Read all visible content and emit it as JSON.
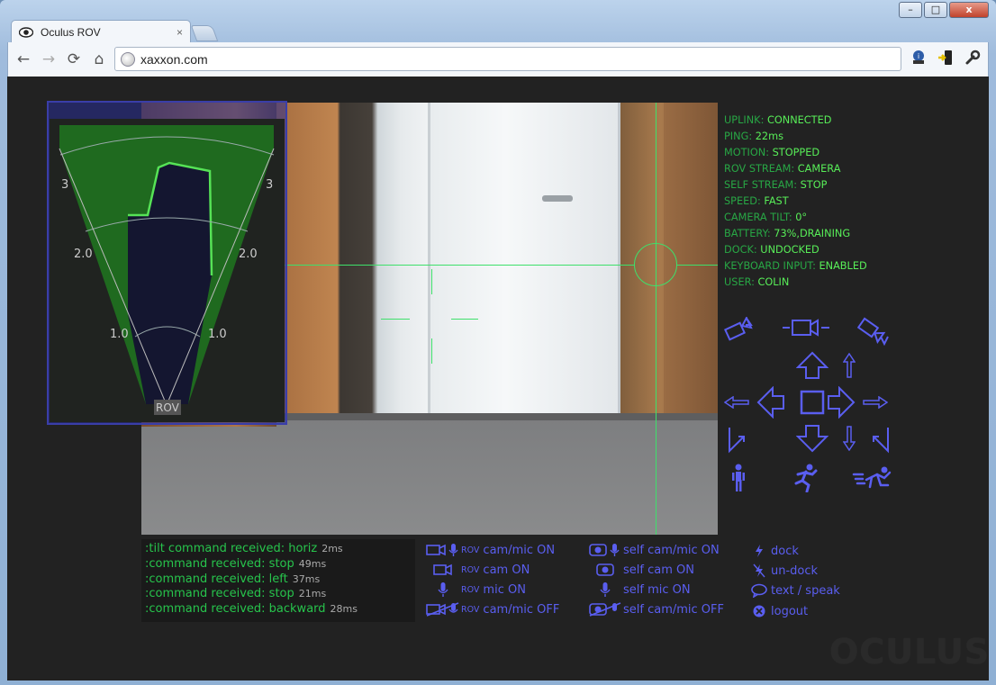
{
  "browser": {
    "tab_title": "Oculus ROV",
    "tab_close": "×",
    "url": "xaxxon.com",
    "controls": {
      "minimize": "–",
      "maximize": "□",
      "close": "x"
    },
    "nav": {
      "back": "←",
      "forward": "→",
      "reload": "⟳",
      "home": "⌂"
    }
  },
  "radar": {
    "labels": {
      "left_outer": "3",
      "right_outer": "3",
      "left_mid": "2.0",
      "right_mid": "2.0",
      "left_near": "1.0",
      "right_near": "1.0",
      "origin": "ROV"
    },
    "colors": {
      "fov": "#1f6a1f",
      "obstacle": "#56e356",
      "free": "#141630"
    }
  },
  "status": [
    {
      "key": "UPLINK:",
      "value": "CONNECTED"
    },
    {
      "key": "PING:",
      "value": "22ms"
    },
    {
      "key": "MOTION:",
      "value": "STOPPED"
    },
    {
      "key": "ROV STREAM:",
      "value": "CAMERA"
    },
    {
      "key": "SELF STREAM:",
      "value": "STOP"
    },
    {
      "key": "SPEED:",
      "value": "FAST"
    },
    {
      "key": "CAMERA TILT:",
      "value": "0°"
    },
    {
      "key": "BATTERY:",
      "value": "73%,DRAINING"
    },
    {
      "key": "DOCK:",
      "value": "UNDOCKED"
    },
    {
      "key": "KEYBOARD INPUT:",
      "value": "ENABLED"
    },
    {
      "key": "USER:",
      "value": "COLIN"
    }
  ],
  "console": [
    {
      "msg": ":tilt command received: horiz",
      "time": "2ms"
    },
    {
      "msg": ":command received: stop",
      "time": "49ms"
    },
    {
      "msg": ":command received: left",
      "time": "37ms"
    },
    {
      "msg": ":command received: stop",
      "time": "21ms"
    },
    {
      "msg": ":command received: backward",
      "time": "28ms"
    }
  ],
  "media": {
    "rov": [
      {
        "prefix": "ROV",
        "label": "cam/mic ON",
        "icon": "camera-mic-icon"
      },
      {
        "prefix": "ROV",
        "label": "cam ON",
        "icon": "camera-icon"
      },
      {
        "prefix": "ROV",
        "label": "mic ON",
        "icon": "mic-icon"
      },
      {
        "prefix": "ROV",
        "label": "cam/mic OFF",
        "icon": "camera-mic-off-icon"
      }
    ],
    "self": [
      {
        "label": "self cam/mic ON",
        "icon": "webcam-mic-icon"
      },
      {
        "label": "self cam ON",
        "icon": "webcam-icon"
      },
      {
        "label": "self mic ON",
        "icon": "mic-icon"
      },
      {
        "label": "self cam/mic OFF",
        "icon": "webcam-mic-off-icon"
      }
    ]
  },
  "actions": [
    {
      "label": "dock",
      "icon": "dock-icon"
    },
    {
      "label": "un-dock",
      "icon": "undock-icon"
    },
    {
      "label": "text / speak",
      "icon": "speech-bubble-icon"
    },
    {
      "label": "logout",
      "icon": "logout-icon"
    }
  ],
  "logo": "OCULUS",
  "accent": "#5a5ef0"
}
